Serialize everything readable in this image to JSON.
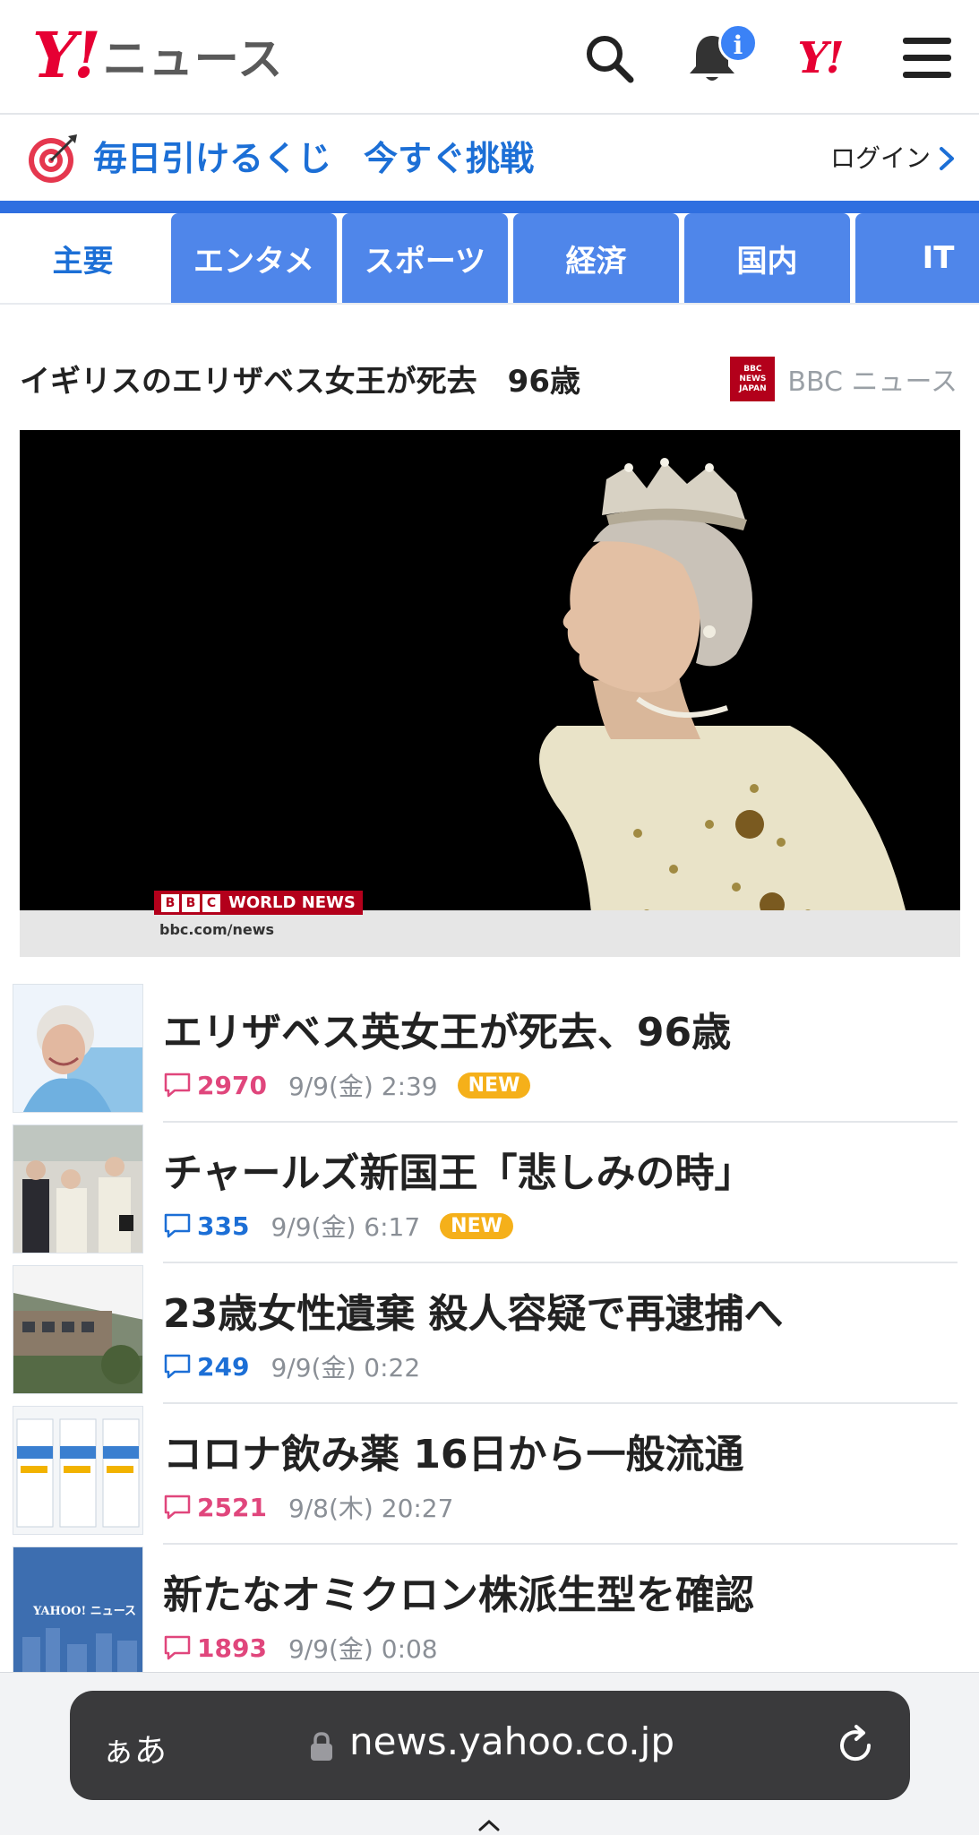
{
  "header": {
    "logo_mark": "Y!",
    "logo_text": "ニュース",
    "notification_badge": "i",
    "yj_mark": "Y!",
    "icons": [
      "search-icon",
      "bell-icon",
      "yahoo-japan-icon",
      "menu-icon"
    ]
  },
  "promo": {
    "text": "毎日引けるくじ",
    "cta": "今すぐ挑戦",
    "login": "ログイン",
    "accent_color": "#1c6fd6"
  },
  "tabs": [
    {
      "label": "主要",
      "active": true
    },
    {
      "label": "エンタメ",
      "active": false
    },
    {
      "label": "スポーツ",
      "active": false
    },
    {
      "label": "経済",
      "active": false
    },
    {
      "label": "国内",
      "active": false
    },
    {
      "label": "IT",
      "active": false
    }
  ],
  "top_story": {
    "headline": "イギリスのエリザベス女王が死去　96歳",
    "source": "BBC ニュース",
    "source_logo_text": [
      "BBC",
      "NEWS",
      "JAPAN"
    ],
    "video_overlay": {
      "brand_letters": [
        "B",
        "B",
        "C"
      ],
      "brand_text": "WORLD NEWS",
      "url": "bbc.com/news"
    }
  },
  "articles": [
    {
      "title": "エリザベス英女王が死去、96歳",
      "comments": "2970",
      "comment_color": "pink",
      "date": "9/9(金) 2:39",
      "badge": "NEW"
    },
    {
      "title": "チャールズ新国王「悲しみの時」",
      "comments": "335",
      "comment_color": "blue",
      "date": "9/9(金) 6:17",
      "badge": "NEW"
    },
    {
      "title": "23歳女性遺棄 殺人容疑で再逮捕へ",
      "comments": "249",
      "comment_color": "blue",
      "date": "9/9(金) 0:22",
      "badge": ""
    },
    {
      "title": "コロナ飲み薬 16日から一般流通",
      "comments": "2521",
      "comment_color": "pink",
      "date": "9/8(木) 20:27",
      "badge": ""
    },
    {
      "title": "新たなオミクロン株派生型を確認",
      "comments": "1893",
      "comment_color": "pink",
      "date": "9/9(金) 0:08",
      "badge": ""
    }
  ],
  "thumb_text": "YAHOO! ニュース",
  "browser": {
    "aa_label": "ぁあ",
    "url": "news.yahoo.co.jp"
  },
  "colors": {
    "brand_red": "#e60033",
    "tab_blue": "#4f86ea",
    "stripe_blue": "#2f6fe0",
    "comment_pink": "#e0467c",
    "new_badge": "#f5b01a"
  }
}
